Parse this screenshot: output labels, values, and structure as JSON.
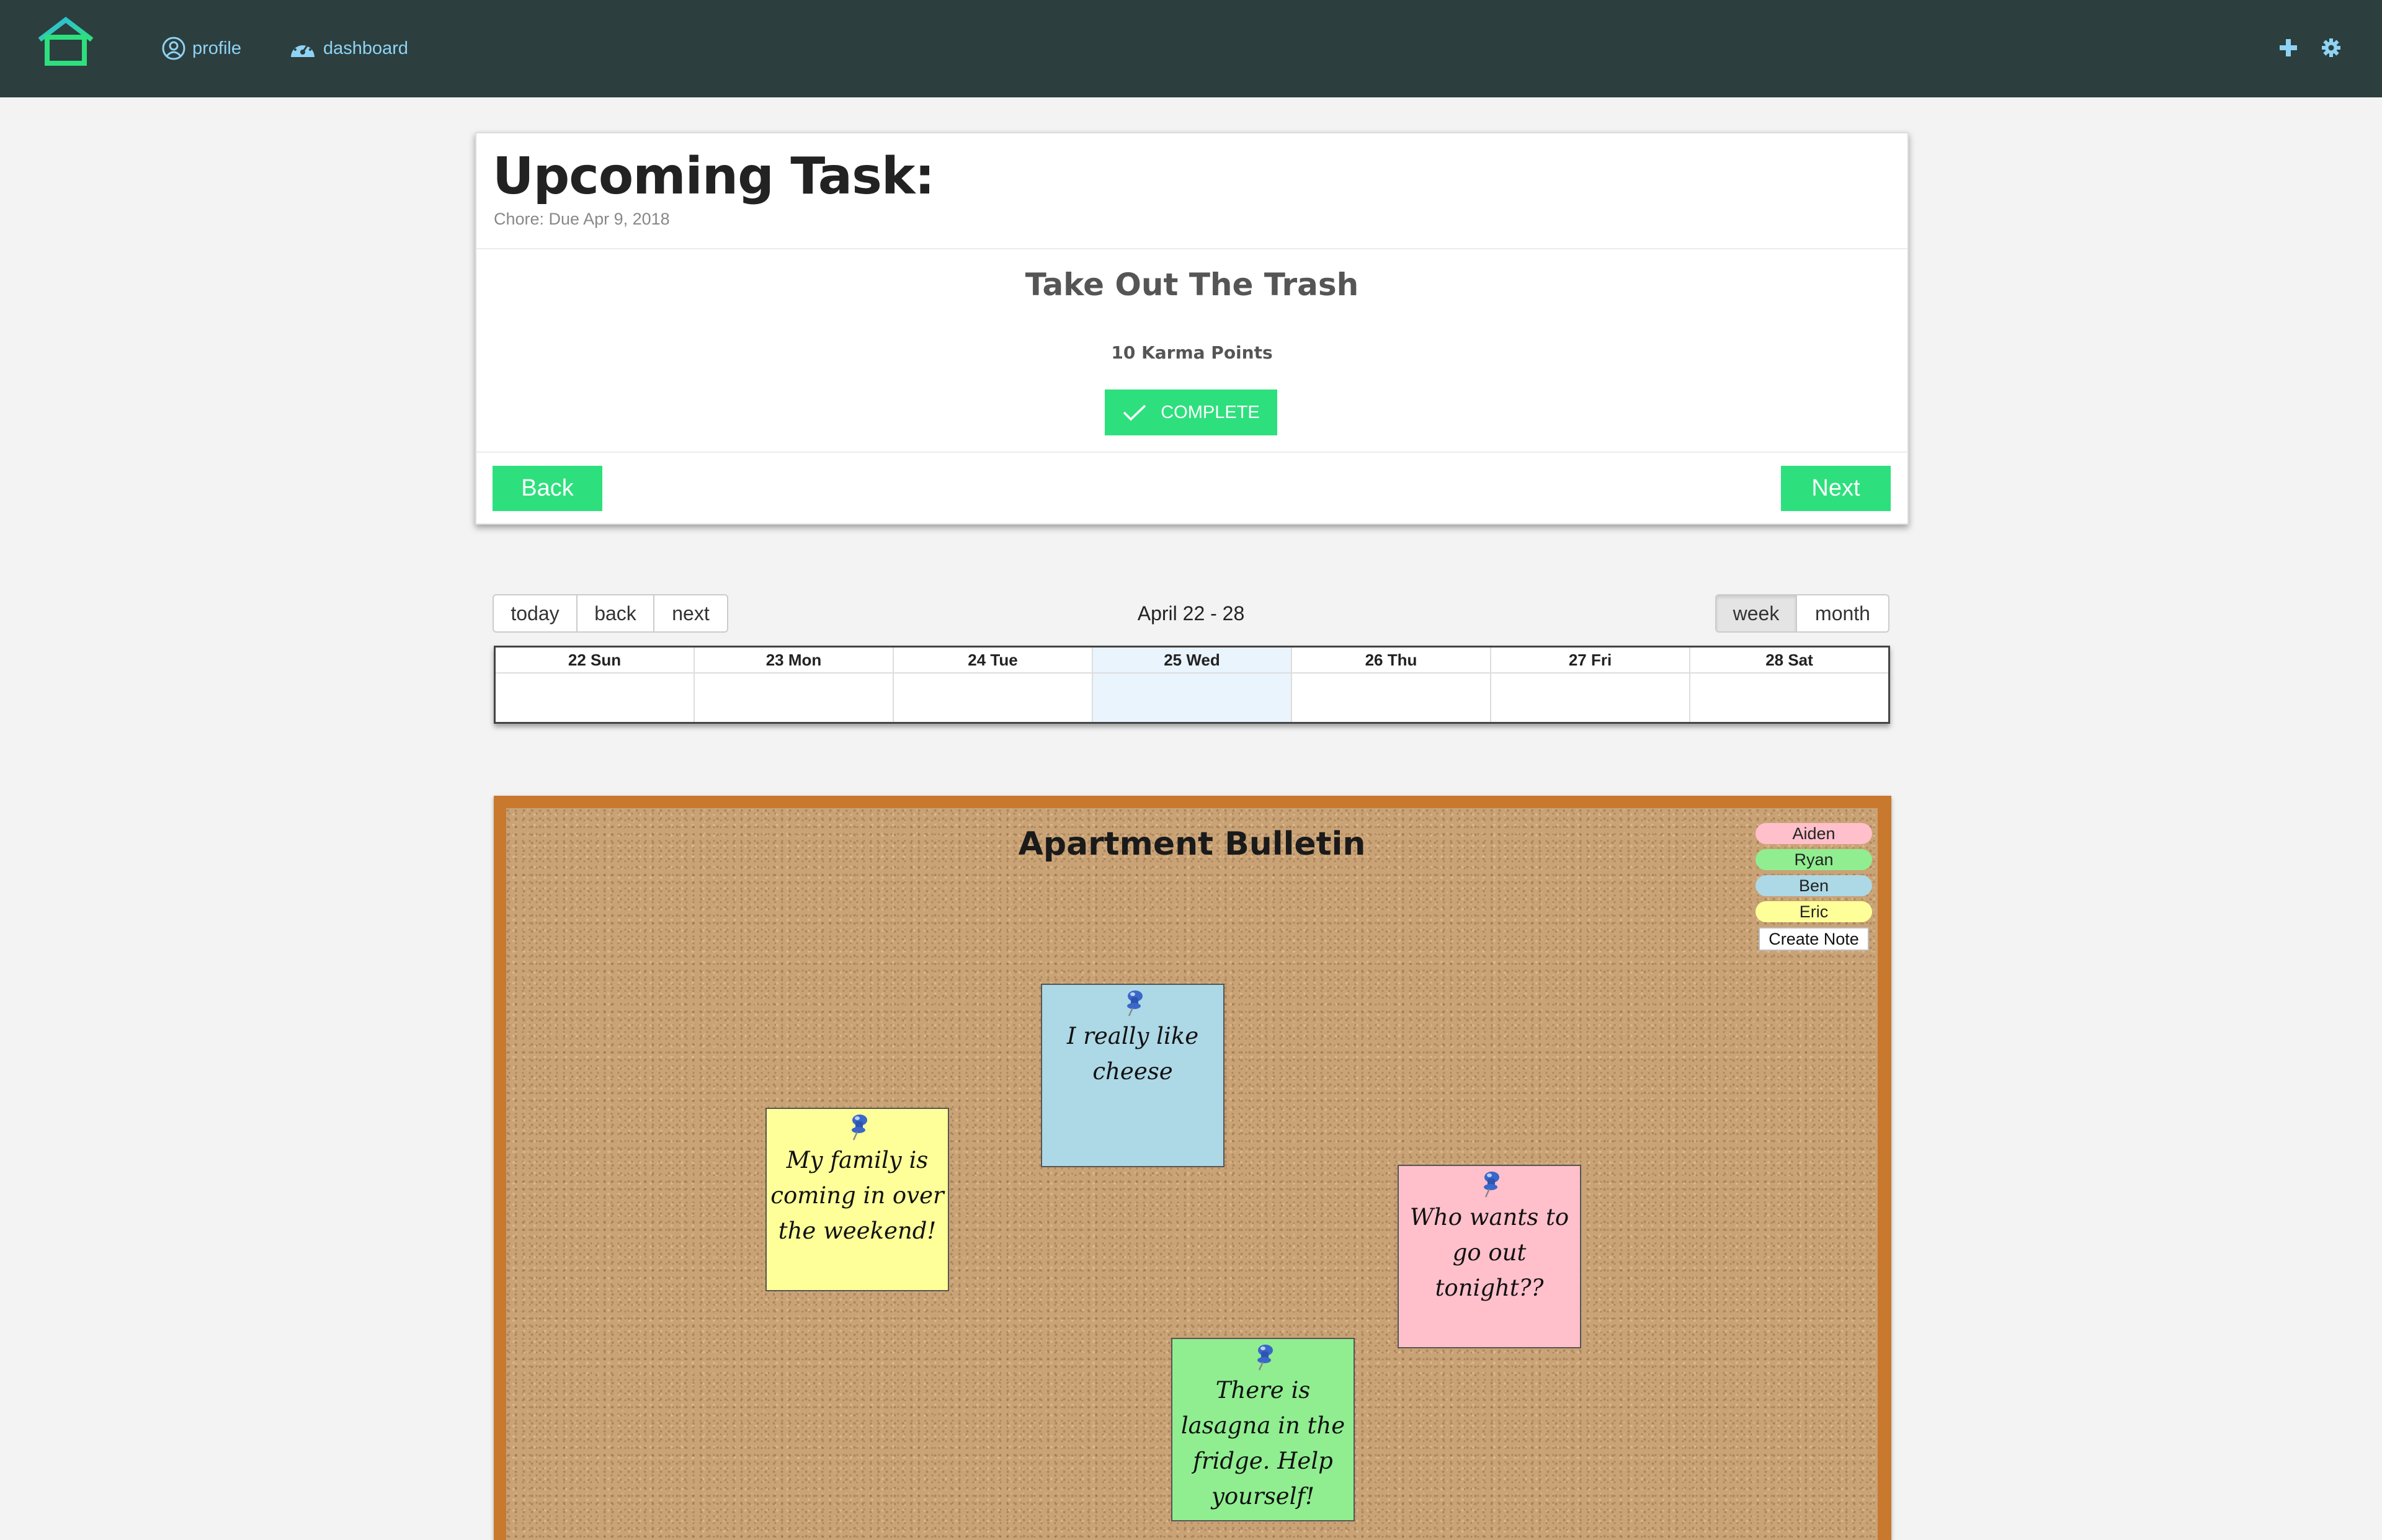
{
  "nav": {
    "profile_label": "profile",
    "dashboard_label": "dashboard",
    "icons": [
      "home-logo-icon",
      "user-circle-icon",
      "dashboard-gauge-icon",
      "plus-icon",
      "gear-icon"
    ]
  },
  "task": {
    "heading": "Upcoming Task:",
    "subtitle": "Chore: Due Apr 9, 2018",
    "name": "Take Out The Trash",
    "karma": "10 Karma Points",
    "complete_label": "COMPLETE",
    "back_label": "Back",
    "next_label": "Next",
    "accent_color": "#2de07d"
  },
  "calendar": {
    "today_label": "today",
    "back_label": "back",
    "next_label": "next",
    "range": "April 22 - 28",
    "week_label": "week",
    "month_label": "month",
    "active_view": "week",
    "days": [
      "22 Sun",
      "23 Mon",
      "24 Tue",
      "25 Wed",
      "26 Thu",
      "27 Fri",
      "28 Sat"
    ],
    "today_day": "25 Wed"
  },
  "bulletin": {
    "title": "Apartment Bulletin",
    "legend": [
      {
        "name": "Aiden",
        "color": "#ffc0cb"
      },
      {
        "name": "Ryan",
        "color": "#90ee90"
      },
      {
        "name": "Ben",
        "color": "#add8e6"
      },
      {
        "name": "Eric",
        "color": "#ffff99"
      }
    ],
    "create_note_label": "Create Note",
    "notes": [
      {
        "text": "I really like cheese",
        "author": "Ben",
        "color": "#add8e6"
      },
      {
        "text": "My family is coming in over the weekend!",
        "author": "Eric",
        "color": "#ffff99"
      },
      {
        "text": "Who wants to go out tonight??",
        "author": "Aiden",
        "color": "#ffc0cb"
      },
      {
        "text": "There is lasagna in the fridge. Help yourself!",
        "author": "Ryan",
        "color": "#90ee90"
      }
    ]
  }
}
